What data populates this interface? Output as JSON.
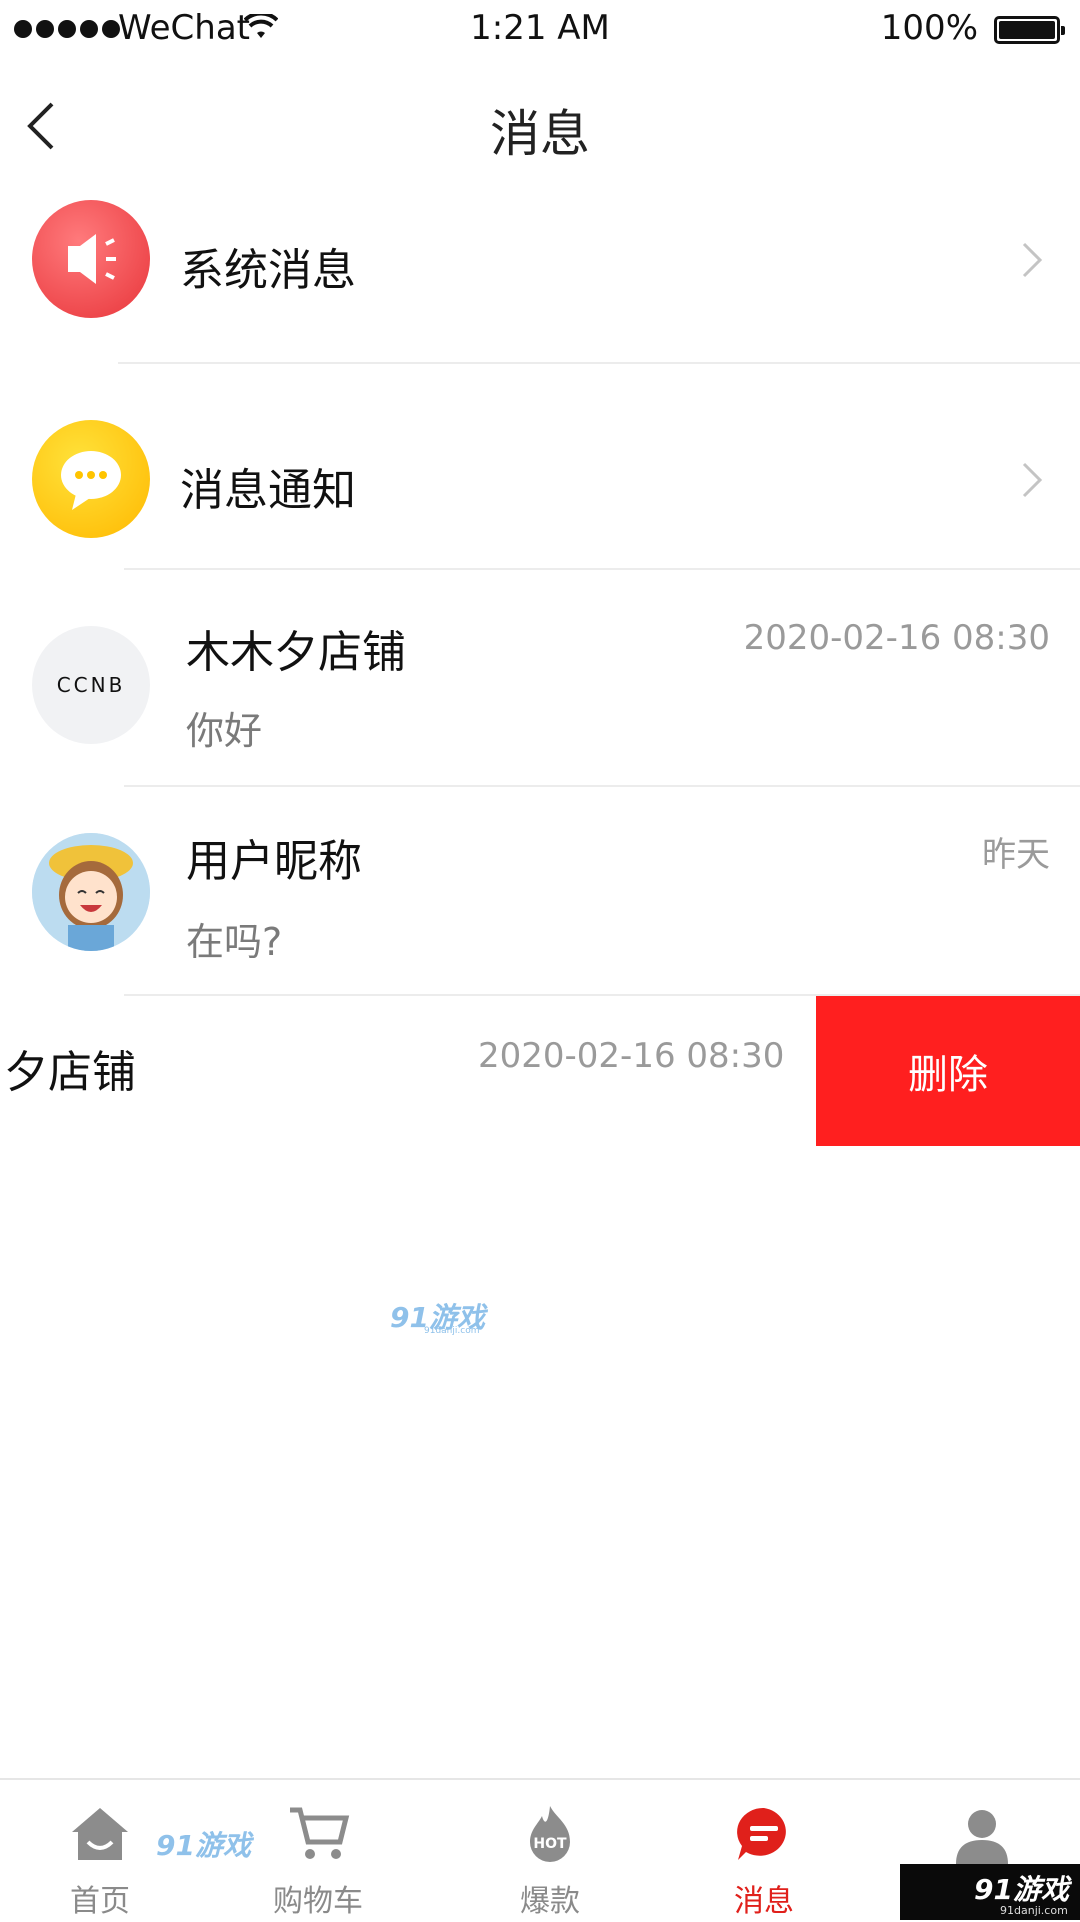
{
  "status_bar": {
    "carrier": "WeChat",
    "time": "1:21 AM",
    "battery": "100%"
  },
  "nav": {
    "title": "消息",
    "back_icon": "chevron-left-icon"
  },
  "rows": [
    {
      "name": "系统消息",
      "icon": "speaker-icon",
      "icon_color": "#f2484b"
    },
    {
      "name": "消息通知",
      "icon": "chat-bubble-icon",
      "icon_color": "#ffc400"
    },
    {
      "name": "木木夕店铺",
      "time": "2020-02-16 08:30",
      "message": "你好",
      "avatar_text": "CCNB"
    },
    {
      "name": "用户昵称",
      "time": "昨天",
      "message": "在吗?"
    },
    {
      "name": "夕店铺",
      "time": "2020-02-16 08:30",
      "action": "删除"
    }
  ],
  "watermark": {
    "text": "91游戏",
    "sub": "91danji.com"
  },
  "tabs": [
    {
      "label": "首页",
      "icon": "home-icon",
      "active": false
    },
    {
      "label": "购物车",
      "icon": "cart-icon",
      "active": false
    },
    {
      "label": "爆款",
      "icon": "hot-flame-icon",
      "active": false,
      "badge": "HOT"
    },
    {
      "label": "消息",
      "icon": "message-icon",
      "active": true
    },
    {
      "label": "",
      "icon": "user-icon",
      "active": false
    }
  ],
  "colors": {
    "accent": "#e0201b",
    "delete": "#ff1f1f",
    "muted": "#9a9a9a"
  }
}
